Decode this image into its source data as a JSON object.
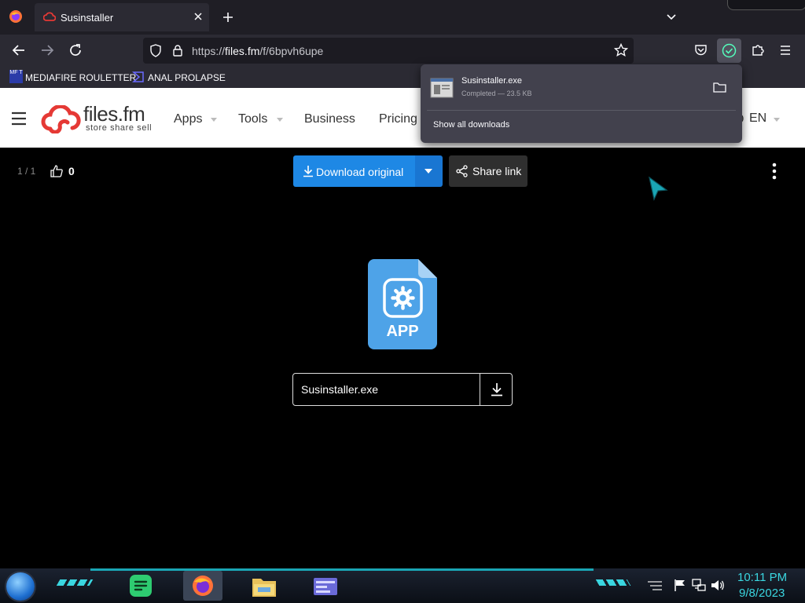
{
  "browser": {
    "tab_title": "Susinstaller",
    "url_prefix": "https://",
    "url_host": "files.fm",
    "url_path": "/f/6bpvh6upe",
    "bookmarks": [
      {
        "label": "MEDIAFIRE ROULETTER",
        "badge": "MF T"
      },
      {
        "label": "ANAL PROLAPSE"
      }
    ]
  },
  "downloads_panel": {
    "filename": "Susinstaller.exe",
    "status": "Completed — 23.5 KB",
    "show_all": "Show all downloads"
  },
  "site": {
    "logo_name": "files.fm",
    "logo_tagline": "store share sell",
    "nav": [
      "Apps",
      "Tools",
      "Business",
      "Pricing"
    ],
    "language": "EN"
  },
  "viewer": {
    "page_counter": "1 / 1",
    "likes": "0",
    "download_label": "Download original",
    "share_label": "Share link",
    "file_type_label": "APP",
    "filename": "Susinstaller.exe"
  },
  "taskbar": {
    "time": "10:11 PM",
    "date": "9/8/2023"
  },
  "colors": {
    "accent_blue": "#1e88e5",
    "brand_red": "#e53935",
    "clock_cyan": "#3ad6e0"
  }
}
